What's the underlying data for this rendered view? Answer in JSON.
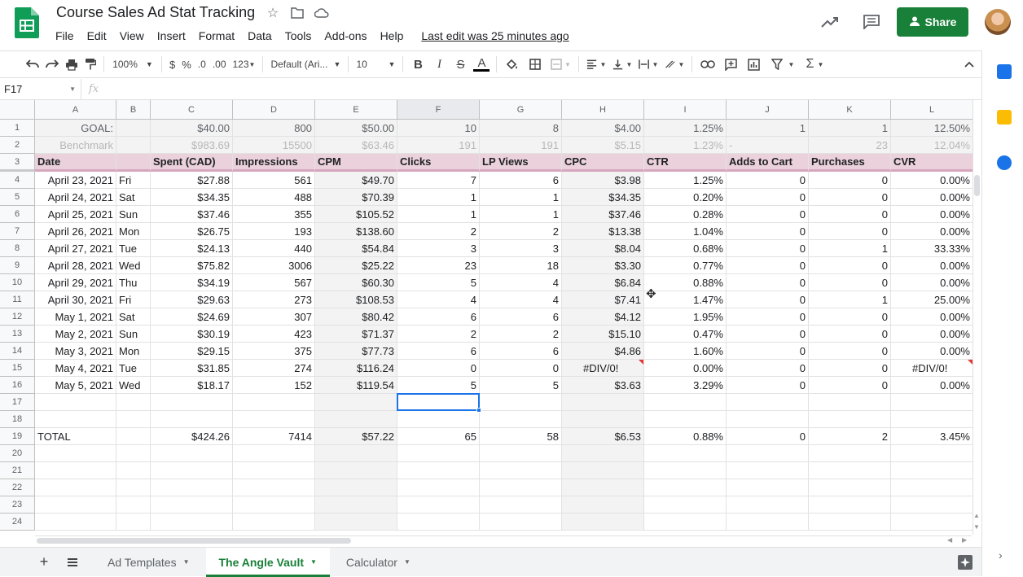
{
  "app": {
    "title": "Course Sales Ad Stat Tracking",
    "menu": [
      "File",
      "Edit",
      "View",
      "Insert",
      "Format",
      "Data",
      "Tools",
      "Add-ons",
      "Help"
    ],
    "last_edit": "Last edit was 25 minutes ago",
    "share_label": "Share",
    "icons": [
      "star-icon",
      "move-to-folder-icon",
      "cloud-status-icon",
      "trend-icon",
      "comment-icon"
    ]
  },
  "toolbar": {
    "zoom": "100%",
    "currency": "$",
    "percent": "%",
    "dec_less": ".0",
    "dec_more": ".00",
    "more_formats": "123",
    "font": "Default (Ari...",
    "font_size": "10",
    "bold": "B",
    "italic": "I",
    "strike": "S",
    "text_color": "A",
    "function": "Σ"
  },
  "formula_bar": {
    "cell_ref": "F17",
    "fx": "fx",
    "value": ""
  },
  "columns": [
    "A",
    "B",
    "C",
    "D",
    "E",
    "F",
    "G",
    "H",
    "I",
    "J",
    "K",
    "L"
  ],
  "rows": [
    {
      "n": "1",
      "type": "goal",
      "cells": [
        "GOAL:",
        "",
        "$40.00",
        "800",
        "$50.00",
        "10",
        "8",
        "$4.00",
        "1.25%",
        "1",
        "1",
        "12.50%"
      ]
    },
    {
      "n": "2",
      "type": "bench",
      "cells": [
        "Benchmark",
        "",
        "$983.69",
        "15500",
        "$63.46",
        "191",
        "191",
        "$5.15",
        "1.23%",
        "-",
        "23",
        "12.04%"
      ]
    },
    {
      "n": "3",
      "type": "hdr",
      "cells": [
        "Date",
        "",
        "Spent (CAD)",
        "Impressions",
        "CPM",
        "Clicks",
        "LP Views",
        "CPC",
        "CTR",
        "Adds to Cart",
        "Purchases",
        "CVR"
      ]
    },
    {
      "n": "4",
      "type": "data",
      "cells": [
        "April 23, 2021",
        "Fri",
        "$27.88",
        "561",
        "$49.70",
        "7",
        "6",
        "$3.98",
        "1.25%",
        "0",
        "0",
        "0.00%"
      ]
    },
    {
      "n": "5",
      "type": "data",
      "cells": [
        "April 24, 2021",
        "Sat",
        "$34.35",
        "488",
        "$70.39",
        "1",
        "1",
        "$34.35",
        "0.20%",
        "0",
        "0",
        "0.00%"
      ]
    },
    {
      "n": "6",
      "type": "data",
      "cells": [
        "April 25, 2021",
        "Sun",
        "$37.46",
        "355",
        "$105.52",
        "1",
        "1",
        "$37.46",
        "0.28%",
        "0",
        "0",
        "0.00%"
      ]
    },
    {
      "n": "7",
      "type": "data",
      "cells": [
        "April 26, 2021",
        "Mon",
        "$26.75",
        "193",
        "$138.60",
        "2",
        "2",
        "$13.38",
        "1.04%",
        "0",
        "0",
        "0.00%"
      ]
    },
    {
      "n": "8",
      "type": "data",
      "cells": [
        "April 27, 2021",
        "Tue",
        "$24.13",
        "440",
        "$54.84",
        "3",
        "3",
        "$8.04",
        "0.68%",
        "0",
        "1",
        "33.33%"
      ]
    },
    {
      "n": "9",
      "type": "data",
      "cells": [
        "April 28, 2021",
        "Wed",
        "$75.82",
        "3006",
        "$25.22",
        "23",
        "18",
        "$3.30",
        "0.77%",
        "0",
        "0",
        "0.00%"
      ]
    },
    {
      "n": "10",
      "type": "data",
      "cells": [
        "April 29, 2021",
        "Thu",
        "$34.19",
        "567",
        "$60.30",
        "5",
        "4",
        "$6.84",
        "0.88%",
        "0",
        "0",
        "0.00%"
      ]
    },
    {
      "n": "11",
      "type": "data",
      "cells": [
        "April 30, 2021",
        "Fri",
        "$29.63",
        "273",
        "$108.53",
        "4",
        "4",
        "$7.41",
        "1.47%",
        "0",
        "1",
        "25.00%"
      ]
    },
    {
      "n": "12",
      "type": "data",
      "cells": [
        "May 1, 2021",
        "Sat",
        "$24.69",
        "307",
        "$80.42",
        "6",
        "6",
        "$4.12",
        "1.95%",
        "0",
        "0",
        "0.00%"
      ]
    },
    {
      "n": "13",
      "type": "data",
      "cells": [
        "May 2, 2021",
        "Sun",
        "$30.19",
        "423",
        "$71.37",
        "2",
        "2",
        "$15.10",
        "0.47%",
        "0",
        "0",
        "0.00%"
      ]
    },
    {
      "n": "14",
      "type": "data",
      "cells": [
        "May 3, 2021",
        "Mon",
        "$29.15",
        "375",
        "$77.73",
        "6",
        "6",
        "$4.86",
        "1.60%",
        "0",
        "0",
        "0.00%"
      ]
    },
    {
      "n": "15",
      "type": "data",
      "cells": [
        "May 4, 2021",
        "Tue",
        "$31.85",
        "274",
        "$116.24",
        "0",
        "0",
        "#DIV/0!",
        "0.00%",
        "0",
        "0",
        "#DIV/0!"
      ]
    },
    {
      "n": "16",
      "type": "data",
      "cells": [
        "May 5, 2021",
        "Wed",
        "$18.17",
        "152",
        "$119.54",
        "5",
        "5",
        "$3.63",
        "3.29%",
        "0",
        "0",
        "0.00%"
      ]
    },
    {
      "n": "17",
      "type": "empty",
      "cells": [
        "",
        "",
        "",
        "",
        "",
        "",
        "",
        "",
        "",
        "",
        "",
        ""
      ]
    },
    {
      "n": "18",
      "type": "empty",
      "cells": [
        "",
        "",
        "",
        "",
        "",
        "",
        "",
        "",
        "",
        "",
        "",
        ""
      ]
    },
    {
      "n": "19",
      "type": "total",
      "cells": [
        "TOTAL",
        "",
        "$424.26",
        "7414",
        "$57.22",
        "65",
        "58",
        "$6.53",
        "0.88%",
        "0",
        "2",
        "3.45%"
      ]
    },
    {
      "n": "20",
      "type": "empty",
      "cells": [
        "",
        "",
        "",
        "",
        "",
        "",
        "",
        "",
        "",
        "",
        "",
        ""
      ]
    },
    {
      "n": "21",
      "type": "empty",
      "cells": [
        "",
        "",
        "",
        "",
        "",
        "",
        "",
        "",
        "",
        "",
        "",
        ""
      ]
    },
    {
      "n": "22",
      "type": "empty",
      "cells": [
        "",
        "",
        "",
        "",
        "",
        "",
        "",
        "",
        "",
        "",
        "",
        ""
      ]
    },
    {
      "n": "23",
      "type": "empty",
      "cells": [
        "",
        "",
        "",
        "",
        "",
        "",
        "",
        "",
        "",
        "",
        "",
        ""
      ]
    },
    {
      "n": "24",
      "type": "empty",
      "cells": [
        "",
        "",
        "",
        "",
        "",
        "",
        "",
        "",
        "",
        "",
        "",
        ""
      ]
    }
  ],
  "sheets": [
    {
      "label": "Ad Templates",
      "active": false
    },
    {
      "label": "The Angle Vault",
      "active": true
    },
    {
      "label": "Calculator",
      "active": false
    }
  ],
  "colors": {
    "accent": "#188038",
    "header_fill": "#ead1dc",
    "selection": "#1a73e8"
  }
}
